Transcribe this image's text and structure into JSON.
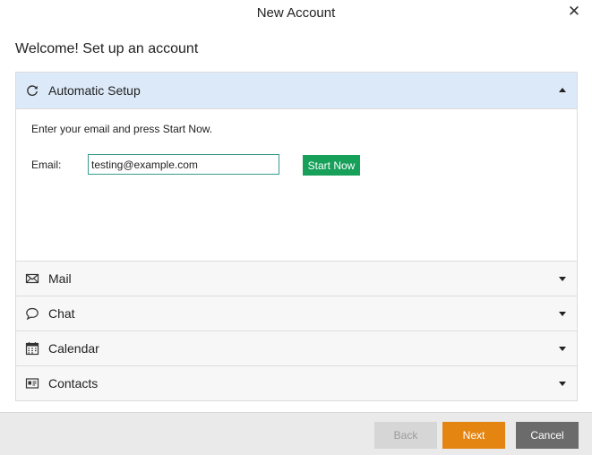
{
  "window": {
    "title": "New Account",
    "close_glyph": "✕"
  },
  "welcome": "Welcome! Set up an account",
  "sections": [
    {
      "label": "Automatic Setup",
      "icon": "refresh-icon",
      "expanded": true
    },
    {
      "label": "Mail",
      "icon": "envelope-icon",
      "expanded": false
    },
    {
      "label": "Chat",
      "icon": "chat-bubble-icon",
      "expanded": false
    },
    {
      "label": "Calendar",
      "icon": "calendar-icon",
      "expanded": false
    },
    {
      "label": "Contacts",
      "icon": "contact-card-icon",
      "expanded": false
    }
  ],
  "automatic": {
    "instruction": "Enter your email and press Start Now.",
    "email_label": "Email:",
    "email_value": "testing@example.com",
    "start_label": "Start Now"
  },
  "footer": {
    "back_label": "Back",
    "next_label": "Next",
    "cancel_label": "Cancel"
  },
  "colors": {
    "accent_green": "#16a05a",
    "next_orange": "#e48512",
    "header_blue": "#dce9f8"
  }
}
